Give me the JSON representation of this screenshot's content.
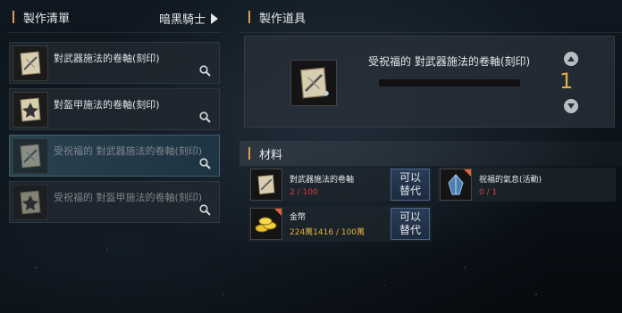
{
  "left_panel": {
    "title": "製作清單",
    "class_filter": "暗黑騎士",
    "recipes": [
      {
        "name": "對武器施法的卷軸(刻印)",
        "icon": "scroll-weapon-icon"
      },
      {
        "name": "對盔甲施法的卷軸(刻印)",
        "icon": "scroll-armor-icon"
      },
      {
        "name": "受祝福的 對武器施法的卷軸(刻印)",
        "icon": "scroll-weapon-icon"
      },
      {
        "name": "受祝福的 對盔甲施法的卷軸(刻印)",
        "icon": "scroll-armor-icon"
      }
    ]
  },
  "tool_panel": {
    "title": "製作道具",
    "item_name": "受祝福的 對武器施法的卷軸(刻印)",
    "quantity": "1"
  },
  "materials_panel": {
    "title": "材料",
    "items": [
      {
        "name": "對武器施法的卷軸",
        "count": "2 / 100",
        "count_color": "red",
        "substitute": "可以替代"
      },
      {
        "name": "祝福的氣息(活動)",
        "count": "0 / 1",
        "count_color": "red"
      },
      {
        "name": "金幣",
        "count": "224萬1416 / 100萬",
        "count_color": "gold",
        "substitute": "可以替代"
      }
    ]
  },
  "colors": {
    "accent_bar": "#e39a4e",
    "quantity": "#e0b040",
    "insufficient": "#d04040",
    "button_blue": "#2a3d57"
  }
}
